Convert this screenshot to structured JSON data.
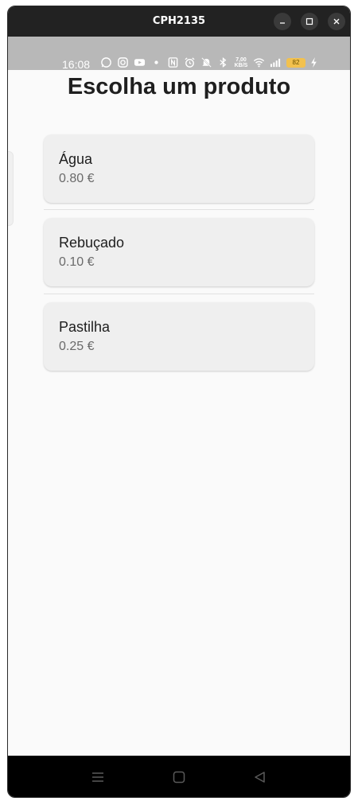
{
  "window": {
    "title": "CPH2135",
    "controls": [
      "minimize-icon",
      "maximize-icon",
      "close-icon"
    ]
  },
  "status_bar": {
    "time": "16:08",
    "net_speed_value": "7,00",
    "net_speed_unit": "KB/S",
    "battery": "82",
    "icons": [
      "whatsapp-icon",
      "instagram-icon",
      "youtube-icon",
      "dot-icon",
      "nfc-icon",
      "alarm-icon",
      "mute-icon",
      "bluetooth-icon",
      "wifi-icon",
      "signal-icon",
      "battery-icon",
      "charging-icon"
    ]
  },
  "page": {
    "title": "Escolha um produto"
  },
  "products": [
    {
      "name": "Água",
      "price": "0.80 €"
    },
    {
      "name": "Rebuçado",
      "price": "0.10 €"
    },
    {
      "name": "Pastilha",
      "price": "0.25 €"
    }
  ],
  "nav_bar": {
    "icons": [
      "menu-icon",
      "home-icon",
      "back-icon"
    ]
  }
}
